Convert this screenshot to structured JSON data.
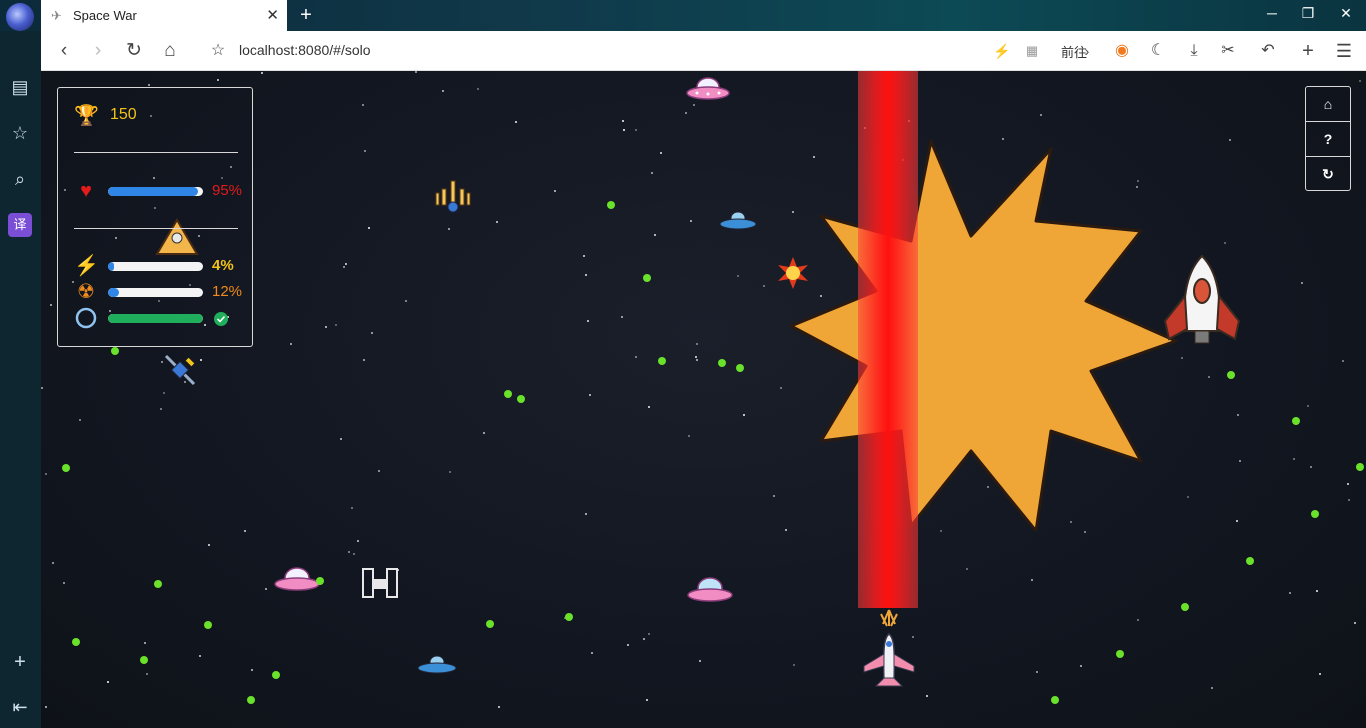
{
  "browser": {
    "tab_title": "Space War",
    "url": "localhost:8080/#/solo",
    "goto_label": "前往",
    "translate_label": "译"
  },
  "hud": {
    "score": "150",
    "health_pct": "95%",
    "health_value": 0.95,
    "energy_pct": "4%",
    "energy_value": 0.04,
    "nuke_pct": "12%",
    "nuke_value": 0.12,
    "shield_value": 1.0
  },
  "colors": {
    "score": "#f2c318",
    "health_bar": "#2f86e6",
    "health_text": "#e21b1b",
    "energy_text": "#f2c318",
    "nuke_text": "#f08a1c",
    "shield_bar": "#1fae5b",
    "explosion": "#f0a636",
    "laser": "#ff1010",
    "particles": "#6ae12a"
  },
  "icons": {
    "score": "trophy-icon",
    "health": "heart-icon",
    "energy": "lightning-icon",
    "nuke": "radiation-icon",
    "shield": "shield-ring-icon",
    "shield_ready": "check-circle-icon",
    "home": "home-icon",
    "help": "question-icon",
    "restart": "refresh-icon"
  },
  "side_buttons": {
    "help_label": "?"
  }
}
